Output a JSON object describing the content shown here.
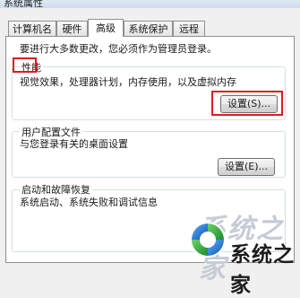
{
  "window": {
    "title": "系统属性"
  },
  "tabs": [
    {
      "label": "计算机名"
    },
    {
      "label": "硬件"
    },
    {
      "label": "高级"
    },
    {
      "label": "系统保护"
    },
    {
      "label": "远程"
    }
  ],
  "admin_note": "要进行大多数更改，您必须作为管理员登录。",
  "performance": {
    "label": "性能",
    "description": "视觉效果，处理器计划，内存使用，以及虚拟内存",
    "button": "设置(S)..."
  },
  "user_profiles": {
    "label": "用户配置文件",
    "description": "与您登录有关的桌面设置",
    "button": "设置(E)..."
  },
  "startup_recovery": {
    "label": "启动和故障恢复",
    "description": "系统启动、系统失败和调试信息"
  },
  "watermark": {
    "text": "系统之家"
  },
  "colors": {
    "highlight": "#e01b22"
  }
}
